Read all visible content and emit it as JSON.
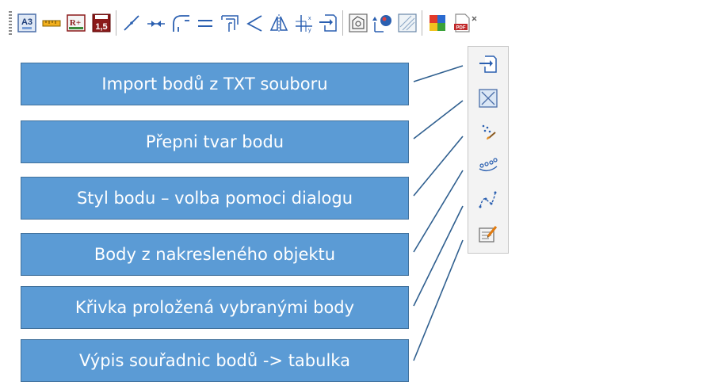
{
  "toolbar": {
    "icons": [
      "paper-size-a3-icon",
      "ruler-icon",
      "raster-icon",
      "text-size-icon",
      "line-icon",
      "arrows-icon",
      "rounded-corner-icon",
      "parallel-lines-icon",
      "dimension-icon",
      "angle-icon",
      "mirror-icon",
      "coordinates-icon",
      "import-points-icon",
      "hatch-polygon-icon",
      "map-pin-icon",
      "hatch-icon",
      "color-palette-icon",
      "pdf-export-icon"
    ],
    "text_size_label": "1,5",
    "paper_label": "A3",
    "raster_label": "R+",
    "pdf_label": "PDF"
  },
  "dropdown": {
    "items": [
      "import-txt-icon",
      "point-shape-icon",
      "point-style-icon",
      "points-from-object-icon",
      "curve-through-points-icon",
      "coordinate-table-icon"
    ]
  },
  "labels": [
    "Import bodů z TXT souboru",
    "Přepni tvar bodu",
    "Styl bodu – volba pomoci dialogu",
    "Body z nakresleného objektu",
    "Křivka proložená vybranými body",
    "Výpis souřadnic bodů -> tabulka"
  ],
  "colors": {
    "label_fill": "#5b9bd5",
    "label_border": "#41719c",
    "connector": "#2f5f8f"
  }
}
